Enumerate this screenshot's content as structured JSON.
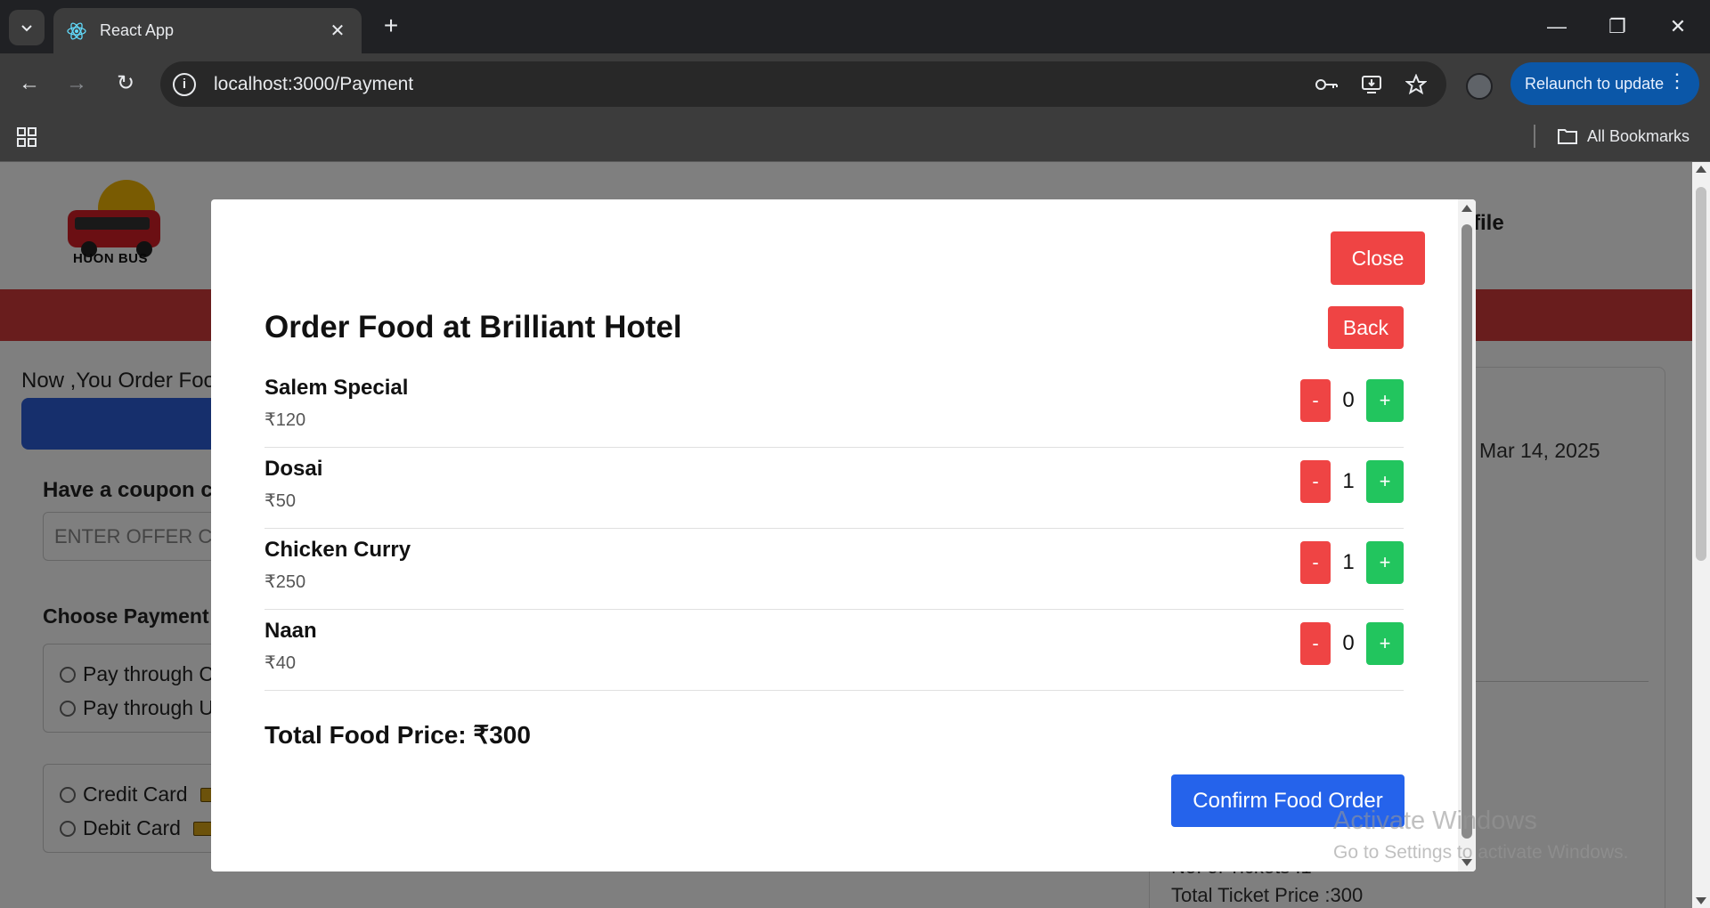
{
  "browser": {
    "tab_title": "React App",
    "url": "localhost:3000/Payment",
    "relaunch_label": "Relaunch to update",
    "all_bookmarks_label": "All Bookmarks"
  },
  "site": {
    "logo_text": "HUON BUS",
    "nav_profile": "rofile",
    "order_note": "Now ,You Order Foo",
    "coupon_title": "Have a coupon co",
    "coupon_placeholder": "ENTER OFFER CO",
    "payment_title": "Choose Payment",
    "pay_options_group1": [
      "Pay through C",
      "Pay through U"
    ],
    "pay_options_group2": [
      "Credit Card",
      "Debit Card"
    ],
    "journey_date": "Mar 14, 2025",
    "tickets_partial": "No. of Tickets :1",
    "total_ticket_price": "Total Ticket Price :300"
  },
  "modal": {
    "close_label": "Close",
    "back_label": "Back",
    "title": "Order Food at Brilliant Hotel",
    "items": [
      {
        "name": "Salem Special",
        "price": "₹120",
        "qty": "0"
      },
      {
        "name": "Dosai",
        "price": "₹50",
        "qty": "1"
      },
      {
        "name": "Chicken Curry",
        "price": "₹250",
        "qty": "1"
      },
      {
        "name": "Naan",
        "price": "₹40",
        "qty": "0"
      }
    ],
    "minus_label": "-",
    "plus_label": "+",
    "total_label": "Total Food Price: ₹300",
    "confirm_label": "Confirm Food Order"
  },
  "watermark": {
    "line1": "Activate Windows",
    "line2": "Go to Settings to activate Windows."
  },
  "colors": {
    "danger": "#ef4444",
    "success": "#22c55e",
    "primary": "#2563eb",
    "brand_red": "#d33a3a"
  }
}
